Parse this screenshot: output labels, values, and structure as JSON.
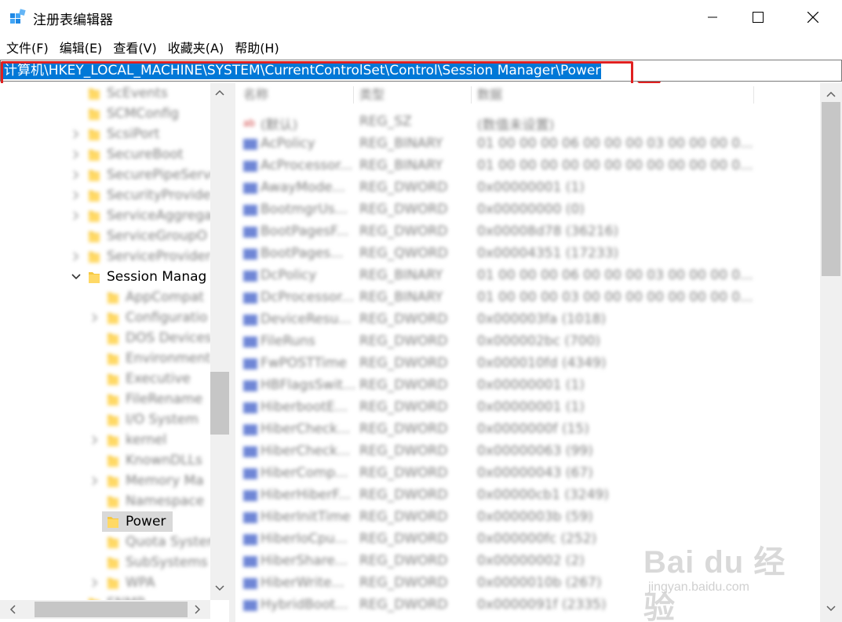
{
  "window": {
    "title": "注册表编辑器",
    "minimize_glyph": "—",
    "close_glyph": "✕"
  },
  "menu": [
    "文件(F)",
    "编辑(E)",
    "查看(V)",
    "收藏夹(A)",
    "帮助(H)"
  ],
  "address": "计算机\\HKEY_LOCAL_MACHINE\\SYSTEM\\CurrentControlSet\\Control\\Session Manager\\Power",
  "tree": [
    {
      "label": "ScEvents",
      "level": 1,
      "expander": "none",
      "blurred": true
    },
    {
      "label": "SCMConfig",
      "level": 1,
      "expander": "none",
      "blurred": true
    },
    {
      "label": "ScsiPort",
      "level": 1,
      "expander": "collapsed",
      "blurred": true
    },
    {
      "label": "SecureBoot",
      "level": 1,
      "expander": "collapsed",
      "blurred": true
    },
    {
      "label": "SecurePipeServe",
      "level": 1,
      "expander": "collapsed",
      "blurred": true
    },
    {
      "label": "SecurityProvide",
      "level": 1,
      "expander": "collapsed",
      "blurred": true
    },
    {
      "label": "ServiceAggrega",
      "level": 1,
      "expander": "collapsed",
      "blurred": true
    },
    {
      "label": "ServiceGroupO",
      "level": 1,
      "expander": "none",
      "blurred": true
    },
    {
      "label": "ServiceProvider",
      "level": 1,
      "expander": "collapsed",
      "blurred": true
    },
    {
      "label": "Session Manag",
      "level": 1,
      "expander": "expanded",
      "blurred": false
    },
    {
      "label": "AppCompat",
      "level": 2,
      "expander": "none",
      "blurred": true
    },
    {
      "label": "Configuratio",
      "level": 2,
      "expander": "collapsed",
      "blurred": true
    },
    {
      "label": "DOS Devices",
      "level": 2,
      "expander": "none",
      "blurred": true
    },
    {
      "label": "Environment",
      "level": 2,
      "expander": "none",
      "blurred": true
    },
    {
      "label": "Executive",
      "level": 2,
      "expander": "none",
      "blurred": true
    },
    {
      "label": "FileRename",
      "level": 2,
      "expander": "none",
      "blurred": true
    },
    {
      "label": "I/O System",
      "level": 2,
      "expander": "none",
      "blurred": true
    },
    {
      "label": "kernel",
      "level": 2,
      "expander": "collapsed",
      "blurred": true
    },
    {
      "label": "KnownDLLs",
      "level": 2,
      "expander": "none",
      "blurred": true
    },
    {
      "label": "Memory Ma",
      "level": 2,
      "expander": "collapsed",
      "blurred": true
    },
    {
      "label": "Namespace",
      "level": 2,
      "expander": "none",
      "blurred": true
    },
    {
      "label": "Power",
      "level": 2,
      "expander": "none",
      "blurred": false,
      "selected": true
    },
    {
      "label": "Quota System",
      "level": 2,
      "expander": "none",
      "blurred": true
    },
    {
      "label": "SubSystems",
      "level": 2,
      "expander": "none",
      "blurred": true
    },
    {
      "label": "WPA",
      "level": 2,
      "expander": "collapsed",
      "blurred": true
    },
    {
      "label": "SNMP",
      "level": 1,
      "expander": "none",
      "blurred": true
    }
  ],
  "columns": {
    "name": "名称",
    "type": "类型",
    "data": "数据"
  },
  "values": [
    {
      "name": "(默认)",
      "type": "REG_SZ",
      "data": "(数值未设置)",
      "icon": "string"
    },
    {
      "name": "AcPolicy",
      "type": "REG_BINARY",
      "data": "01 00 00 00 06 00 00 00 03 00 00 00 0...",
      "icon": "binary"
    },
    {
      "name": "AcProcessor...",
      "type": "REG_BINARY",
      "data": "01 00 00 00 00 00 00 00 00 00 00 00 0...",
      "icon": "binary"
    },
    {
      "name": "AwayMode...",
      "type": "REG_DWORD",
      "data": "0x00000001 (1)",
      "icon": "binary"
    },
    {
      "name": "BootmgrUs...",
      "type": "REG_DWORD",
      "data": "0x00000000 (0)",
      "icon": "binary"
    },
    {
      "name": "BootPagesF...",
      "type": "REG_DWORD",
      "data": "0x00008d78 (36216)",
      "icon": "binary"
    },
    {
      "name": "BootPages...",
      "type": "REG_QWORD",
      "data": "0x00004351 (17233)",
      "icon": "binary"
    },
    {
      "name": "DcPolicy",
      "type": "REG_BINARY",
      "data": "01 00 00 00 06 00 00 00 03 00 00 00 0...",
      "icon": "binary"
    },
    {
      "name": "DcProcessor...",
      "type": "REG_BINARY",
      "data": "01 00 00 00 03 00 00 00 00 00 00 00 0...",
      "icon": "binary"
    },
    {
      "name": "DeviceResu...",
      "type": "REG_DWORD",
      "data": "0x000003fa (1018)",
      "icon": "binary"
    },
    {
      "name": "FileRuns",
      "type": "REG_DWORD",
      "data": "0x000002bc (700)",
      "icon": "binary"
    },
    {
      "name": "FwPOSTTime",
      "type": "REG_DWORD",
      "data": "0x000010fd (4349)",
      "icon": "binary"
    },
    {
      "name": "HBFlagsSwit...",
      "type": "REG_DWORD",
      "data": "0x00000001 (1)",
      "icon": "binary"
    },
    {
      "name": "HiberbootE...",
      "type": "REG_DWORD",
      "data": "0x00000001 (1)",
      "icon": "binary"
    },
    {
      "name": "HiberCheck...",
      "type": "REG_DWORD",
      "data": "0x0000000f (15)",
      "icon": "binary"
    },
    {
      "name": "HiberCheck...",
      "type": "REG_DWORD",
      "data": "0x00000063 (99)",
      "icon": "binary"
    },
    {
      "name": "HiberComp...",
      "type": "REG_DWORD",
      "data": "0x00000043 (67)",
      "icon": "binary"
    },
    {
      "name": "HiberHiberF...",
      "type": "REG_DWORD",
      "data": "0x00000cb1 (3249)",
      "icon": "binary"
    },
    {
      "name": "HiberInitTime",
      "type": "REG_DWORD",
      "data": "0x0000003b (59)",
      "icon": "binary"
    },
    {
      "name": "HiberIoCpu...",
      "type": "REG_DWORD",
      "data": "0x000000fc (252)",
      "icon": "binary"
    },
    {
      "name": "HiberShare...",
      "type": "REG_DWORD",
      "data": "0x00000002 (2)",
      "icon": "binary"
    },
    {
      "name": "HiberWrite...",
      "type": "REG_DWORD",
      "data": "0x0000010b (267)",
      "icon": "binary"
    },
    {
      "name": "HybridBoot...",
      "type": "REG_DWORD",
      "data": "0x0000091f (2335)",
      "icon": "binary"
    }
  ],
  "watermark": {
    "logo": "Bai du 经验",
    "sub": "jingyan.baidu.com"
  }
}
